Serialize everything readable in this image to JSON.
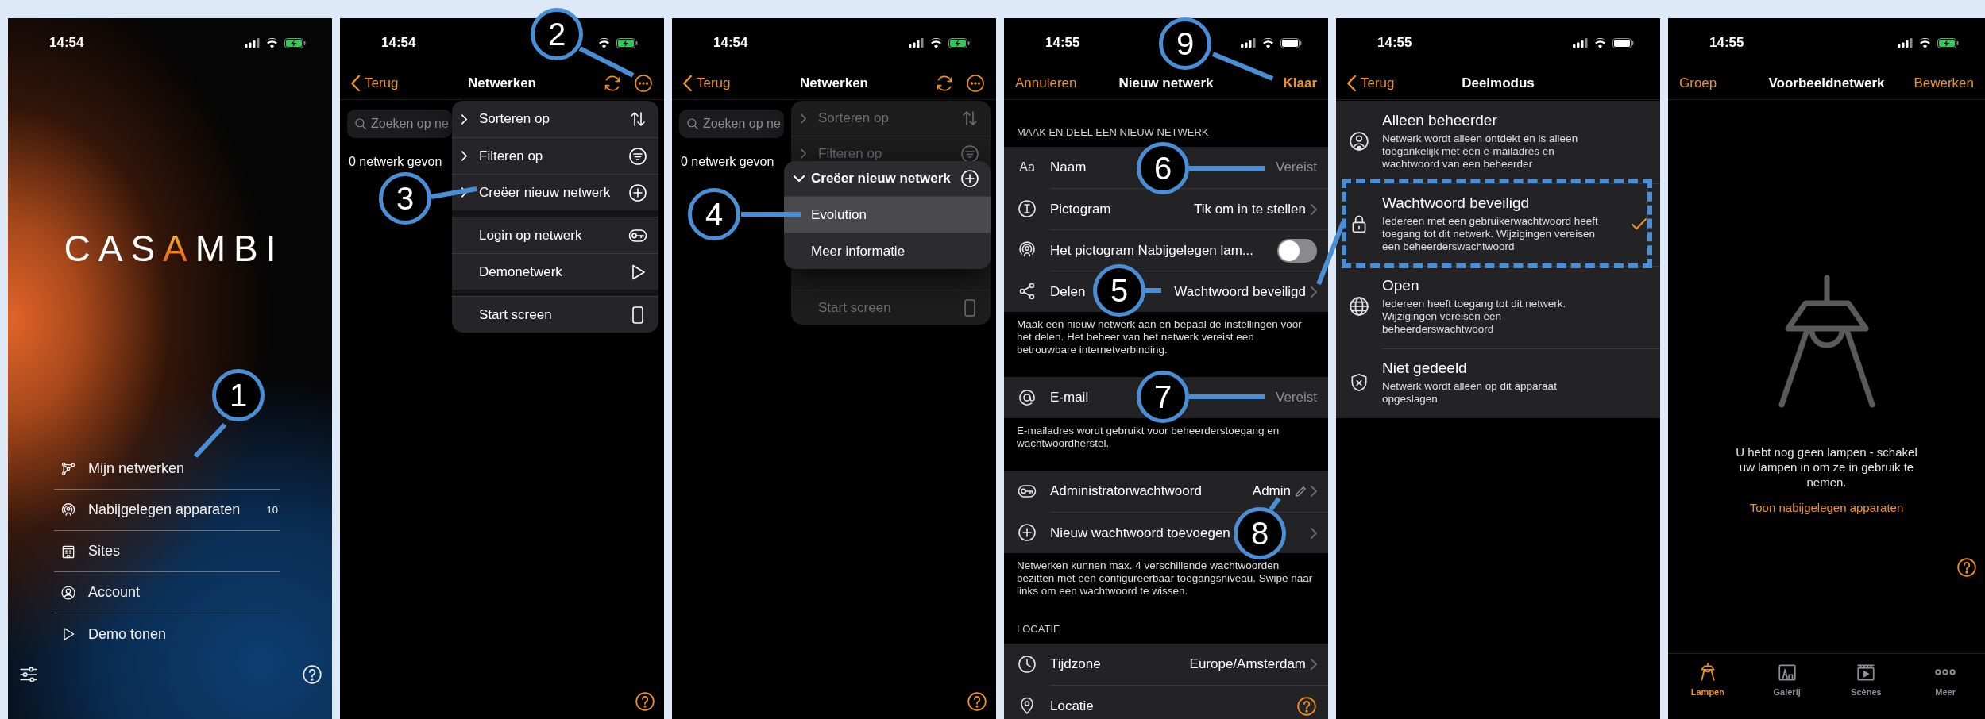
{
  "screens": [
    {
      "kind": "home",
      "status": {
        "time": "14:54",
        "charging": true
      },
      "logo": "CASAMBI",
      "menu": [
        {
          "label": "Mijn netwerken"
        },
        {
          "label": "Nabijgelegen apparaten",
          "badge": "10"
        },
        {
          "label": "Sites"
        },
        {
          "label": "Account"
        },
        {
          "label": "Demo tonen"
        }
      ]
    },
    {
      "kind": "networks",
      "status": {
        "time": "14:54",
        "charging": true
      },
      "nav": {
        "back": "Terug",
        "title": "Netwerken"
      },
      "search": {
        "placeholder": "Zoeken op ne"
      },
      "result": "0 netwerk gevon",
      "menu": {
        "dimmed": false,
        "groups": [
          [
            {
              "label": "Sorteren op",
              "kind": "submenu"
            },
            {
              "label": "Filteren op",
              "kind": "submenu"
            },
            {
              "label": "Creëer nieuw netwerk",
              "kind": "submenu"
            }
          ],
          [
            {
              "label": "Login op netwerk",
              "kind": "action"
            },
            {
              "label": "Demonetwerk",
              "kind": "action"
            }
          ],
          [
            {
              "label": "Start screen",
              "kind": "action"
            }
          ]
        ]
      }
    },
    {
      "kind": "networks",
      "status": {
        "time": "14:54",
        "charging": true
      },
      "nav": {
        "back": "Terug",
        "title": "Netwerken"
      },
      "search": {
        "placeholder": "Zoeken op ne"
      },
      "result": "0 netwerk gevon",
      "menu": {
        "dimmed": true,
        "groups": [
          [
            {
              "label": "Sorteren op",
              "kind": "submenu"
            },
            {
              "label": "Filteren op",
              "kind": "submenu"
            }
          ],
          [
            {
              "label": "Start screen",
              "kind": "action"
            }
          ]
        ]
      },
      "submenu": {
        "title": "Creëer nieuw netwerk",
        "expanded": true,
        "items": [
          {
            "label": "Evolution",
            "selected": true
          },
          {
            "label": "Meer informatie",
            "selected": false
          }
        ]
      }
    },
    {
      "kind": "form",
      "status": {
        "time": "14:55",
        "charging": false
      },
      "nav": {
        "cancel": "Annuleren",
        "title": "Nieuw netwerk",
        "done": "Klaar"
      },
      "sections": [
        {
          "header": "MAAK EN DEEL EEN NIEUW NETWERK",
          "rows": [
            {
              "kind": "field",
              "icon_text": "Aa",
              "label": "Naam",
              "placeholder": "Vereist"
            },
            {
              "kind": "link",
              "label": "Pictogram",
              "value": "Tik om in te stellen"
            },
            {
              "kind": "toggle",
              "label": "Het pictogram Nabijgelegen lam...",
              "on": false
            },
            {
              "kind": "link",
              "label": "Delen",
              "value": "Wachtwoord beveiligd"
            }
          ],
          "footer": "Maak een nieuw netwerk aan en bepaal de instellingen voor het delen. Het beheer van het netwerk vereist een betrouwbare internetverbinding."
        },
        {
          "rows": [
            {
              "kind": "field",
              "label": "E-mail",
              "placeholder": "Vereist"
            }
          ],
          "footer": "E-mailadres wordt gebruikt voor beheerderstoegang en wachtwoordherstel."
        },
        {
          "rows": [
            {
              "kind": "password",
              "label": "Administratorwachtwoord",
              "value": "Admin"
            },
            {
              "kind": "action",
              "label": "Nieuw wachtwoord toevoegen"
            }
          ],
          "footer": "Netwerken kunnen max. 4 verschillende wachtwoorden bezitten met een configureerbaar toegangsniveau. Swipe naar links om een wachtwoord te wissen."
        },
        {
          "header": "LOCATIE",
          "rows": [
            {
              "kind": "link",
              "label": "Tijdzone",
              "value": "Europe/Amsterdam"
            },
            {
              "kind": "help",
              "label": "Locatie"
            }
          ]
        }
      ]
    },
    {
      "kind": "options",
      "status": {
        "time": "14:55",
        "charging": false
      },
      "nav": {
        "back": "Terug",
        "title": "Deelmodus"
      },
      "options": [
        {
          "title": "Alleen beheerder",
          "description": "Netwerk wordt alleen ontdekt en is alleen toegankelijk met een e-mailadres en wachtwoord van een beheerder",
          "selected": false
        },
        {
          "title": "Wachtwoord beveiligd",
          "description": "Iedereen met een gebruikerwachtwoord heeft toegang tot dit netwerk. Wijzigingen vereisen een beheerderswachtwoord",
          "selected": true
        },
        {
          "title": "Open",
          "description": "Iedereen heeft toegang tot dit netwerk. Wijzigingen vereisen een beheerderswachtwoord",
          "selected": false
        },
        {
          "title": "Niet gedeeld",
          "description": "Netwerk wordt alleen op dit apparaat opgeslagen",
          "selected": false
        }
      ]
    },
    {
      "kind": "empty",
      "status": {
        "time": "14:55",
        "charging": true
      },
      "nav": {
        "left": "Groep",
        "title": "Voorbeeldnetwerk",
        "right": "Bewerken"
      },
      "message": "U hebt nog geen lampen - schakel uw lampen in om ze in gebruik te nemen.",
      "link": "Toon nabijgelegen apparaten",
      "tabs": [
        {
          "label": "Lampen",
          "selected": true
        },
        {
          "label": "Galerij",
          "selected": false
        },
        {
          "label": "Scènes",
          "selected": false
        },
        {
          "label": "Meer",
          "selected": false
        }
      ]
    }
  ],
  "callouts": [
    {
      "label": "1"
    },
    {
      "label": "2"
    },
    {
      "label": "3"
    },
    {
      "label": "4"
    },
    {
      "label": "5"
    },
    {
      "label": "6"
    },
    {
      "label": "7"
    },
    {
      "label": "8"
    },
    {
      "label": "9"
    }
  ]
}
